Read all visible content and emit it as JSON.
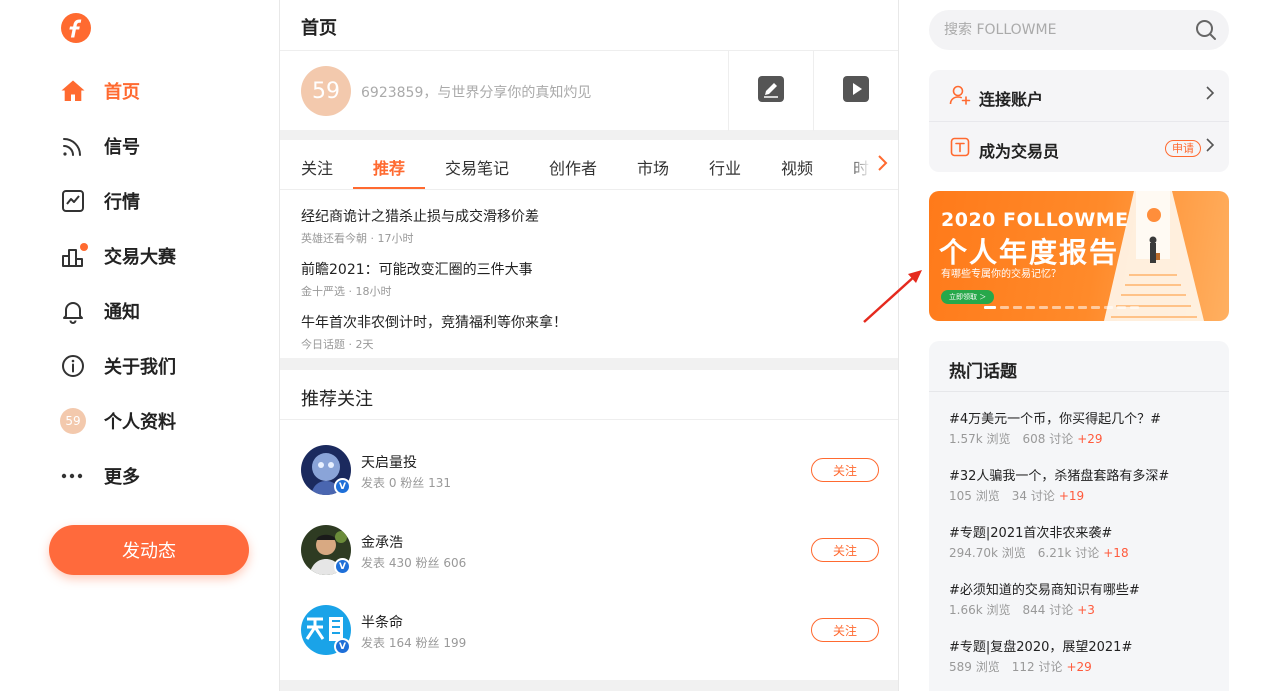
{
  "colors": {
    "accent": "#ff6a30",
    "verified": "#1e6fd8",
    "banner_cta": "#27a84a"
  },
  "sidebar": {
    "items": [
      {
        "label": "首页",
        "icon": "home-icon",
        "active": true
      },
      {
        "label": "信号",
        "icon": "rss-icon"
      },
      {
        "label": "行情",
        "icon": "chart-icon"
      },
      {
        "label": "交易大赛",
        "icon": "podium-icon",
        "dot": true
      },
      {
        "label": "通知",
        "icon": "bell-icon"
      },
      {
        "label": "关于我们",
        "icon": "info-icon"
      },
      {
        "label": "个人资料",
        "icon": "avatar-icon",
        "avatar_text": "59"
      },
      {
        "label": "更多",
        "icon": "more-icon"
      }
    ],
    "post_button": "发动态"
  },
  "header": {
    "title": "首页"
  },
  "composer": {
    "avatar_text": "59",
    "placeholder": "6923859，与世界分享你的真知灼见"
  },
  "tabs": [
    "关注",
    "推荐",
    "交易笔记",
    "创作者",
    "市场",
    "行业",
    "视频",
    "时"
  ],
  "articles": [
    {
      "title": "经纪商诡计之猎杀止损与成交滑移价差",
      "meta": "英雄还看今朝 · 17小时"
    },
    {
      "title": "前瞻2021：可能改变汇圈的三件大事",
      "meta": "金十严选 · 18小时"
    },
    {
      "title": "牛年首次非农倒计时，竞猜福利等你来拿！",
      "meta": "今日话题 · 2天"
    }
  ],
  "recommend": {
    "title": "推荐关注",
    "follow_label": "关注",
    "users": [
      {
        "name": "天启量投",
        "stats": "发表 0 粉丝 131"
      },
      {
        "name": "金承浩",
        "stats": "发表 430 粉丝 606"
      },
      {
        "name": "半条命",
        "stats": "发表 164 粉丝 199"
      }
    ]
  },
  "search": {
    "placeholder": "搜索 FOLLOWME"
  },
  "account": {
    "connect": "连接账户",
    "become_trader": "成为交易员",
    "apply": "申请"
  },
  "banner": {
    "year": "2020 FOLLOWME",
    "title": "个人年度报告",
    "subtitle": "有哪些专属你的交易记忆？",
    "cta": "立即领取 ＞"
  },
  "topics": {
    "title": "热门话题",
    "items": [
      {
        "title": "#4万美元一个币，你买得起几个？#",
        "views": "1.57k 浏览",
        "discuss": "608 讨论",
        "plus": "+29"
      },
      {
        "title": "#32人骗我一个，杀猪盘套路有多深#",
        "views": "105 浏览",
        "discuss": "34 讨论",
        "plus": "+19"
      },
      {
        "title": "#专题|2021首次非农来袭#",
        "views": "294.70k 浏览",
        "discuss": "6.21k 讨论",
        "plus": "+18"
      },
      {
        "title": "#必须知道的交易商知识有哪些#",
        "views": "1.66k 浏览",
        "discuss": "844 讨论",
        "plus": "+3"
      },
      {
        "title": "#专题|复盘2020，展望2021#",
        "views": "589 浏览",
        "discuss": "112 讨论",
        "plus": "+29"
      }
    ]
  }
}
